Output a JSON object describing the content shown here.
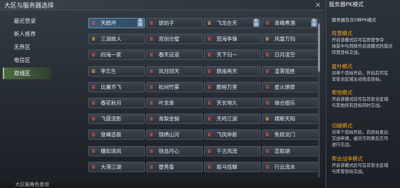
{
  "header": {
    "title": "大区与服务器选择",
    "close_glyph": "×"
  },
  "sidebar": {
    "items": [
      {
        "label": "最近登录",
        "active": false
      },
      {
        "label": "新人推荐",
        "active": false
      },
      {
        "label": "无界区",
        "active": false
      },
      {
        "label": "电信区",
        "active": false
      },
      {
        "label": "双线区",
        "active": true
      }
    ]
  },
  "servers": [
    {
      "name": "天鹤坪",
      "crown": "red",
      "tag": "新服",
      "highlight": true
    },
    {
      "name": "琥珀子",
      "crown": "red",
      "tag": "",
      "highlight": false
    },
    {
      "name": "飞龙在天",
      "crown": "gold",
      "tag": "新服",
      "highlight": false
    },
    {
      "name": "青梅煮酒",
      "crown": "red",
      "tag": "新服",
      "highlight": false
    },
    {
      "name": "江湖故人",
      "crown": "gold",
      "tag": "",
      "highlight": false
    },
    {
      "name": "双剑合璧",
      "crown": "red",
      "tag": "",
      "highlight": false
    },
    {
      "name": "怒海争锋",
      "crown": "red",
      "tag": "",
      "highlight": false
    },
    {
      "name": "风雷万钧",
      "crown": "gold",
      "tag": "",
      "highlight": false
    },
    {
      "name": "四海一家",
      "crown": "red",
      "tag": "",
      "highlight": false
    },
    {
      "name": "春天证道",
      "crown": "red",
      "tag": "",
      "highlight": false
    },
    {
      "name": "天下归一",
      "crown": "red",
      "tag": "",
      "highlight": false
    },
    {
      "name": "日月凌空",
      "crown": "red",
      "tag": "",
      "highlight": false
    },
    {
      "name": "李忘生",
      "crown": "gold",
      "tag": "",
      "highlight": false
    },
    {
      "name": "风月同天",
      "crown": "red",
      "tag": "",
      "highlight": false
    },
    {
      "name": "鹊南再天",
      "crown": "red",
      "tag": "",
      "highlight": false
    },
    {
      "name": "凌霄揽胜",
      "crown": "red",
      "tag": "",
      "highlight": false
    },
    {
      "name": "比翼齐飞",
      "crown": "red",
      "tag": "",
      "highlight": false
    },
    {
      "name": "松间竹雾",
      "crown": "red",
      "tag": "",
      "highlight": false
    },
    {
      "name": "鹏程万里",
      "crown": "red",
      "tag": "",
      "highlight": false
    },
    {
      "name": "星火燎原",
      "crown": "red",
      "tag": "",
      "highlight": false
    },
    {
      "name": "春花秋月",
      "crown": "red",
      "tag": "",
      "highlight": false
    },
    {
      "name": "叶龙青",
      "crown": "red",
      "tag": "",
      "highlight": false
    },
    {
      "name": "天长地久",
      "crown": "red",
      "tag": "",
      "highlight": false
    },
    {
      "name": "缘合佃乐",
      "crown": "red",
      "tag": "",
      "highlight": false
    },
    {
      "name": "飞霞流影",
      "crown": "red",
      "tag": "",
      "highlight": false
    },
    {
      "name": "青梨金骊",
      "crown": "red",
      "tag": "",
      "highlight": false
    },
    {
      "name": "天鸣江湖",
      "crown": "red",
      "tag": "",
      "highlight": false
    },
    {
      "name": "横断天阳",
      "crown": "gold",
      "tag": "",
      "highlight": false
    },
    {
      "name": "登峰造极",
      "crown": "red",
      "tag": "",
      "highlight": false
    },
    {
      "name": "锦绣山河",
      "crown": "red",
      "tag": "",
      "highlight": false
    },
    {
      "name": "飞凤岸新",
      "crown": "red",
      "tag": "",
      "highlight": false
    },
    {
      "name": "鱼跃龙门",
      "crown": "red",
      "tag": "",
      "highlight": false
    },
    {
      "name": "穗如清风",
      "crown": "red",
      "tag": "",
      "highlight": false
    },
    {
      "name": "铁血丹心",
      "crown": "red",
      "tag": "",
      "highlight": false
    },
    {
      "name": "千古风流",
      "crown": "red",
      "tag": "",
      "highlight": false
    },
    {
      "name": "恋叙胡",
      "crown": "red",
      "tag": "",
      "highlight": false
    },
    {
      "name": "大漠江湖",
      "crown": "red",
      "tag": "",
      "highlight": false
    },
    {
      "name": "替秀香",
      "crown": "red",
      "tag": "",
      "highlight": false
    },
    {
      "name": "叙马恬驛",
      "crown": "red",
      "tag": "",
      "highlight": false
    },
    {
      "name": "行云流水",
      "crown": "red",
      "tag": "",
      "highlight": false
    }
  ],
  "footer": {
    "text": "大区服角色查询"
  },
  "info_panel": {
    "title": "服务器PK模式",
    "intro": "服务器包含5种PK模式",
    "modes": [
      {
        "name": "阵营模式",
        "lines": [
          "开启该模式后可在阵营争夺",
          "场景中与同样开启该模式的敌对",
          "阵营目标交战。"
        ]
      },
      {
        "name": "复叶模式",
        "lines": [
          "对单个目标开启，开启后可在",
          "非安全区域主动攻击目标。"
        ]
      },
      {
        "name": "帮怪模式",
        "lines": [
          "开启该模式后可在非安全区域",
          "与其他所有目标同时交战。"
        ]
      },
      {
        "name": "切磋模式",
        "lines": [
          "对单个目标开启，向目标发出",
          "交战申请，被对方同意后方可",
          "进行交战。"
        ]
      },
      {
        "name": "帮会战争模式",
        "lines": [
          "开启该模式后可在非安全区域",
          "与阵营目标交战。"
        ]
      }
    ]
  },
  "colors": {
    "accent_orange": "#f0a820",
    "active_green": "#4b6b43",
    "highlight_blue": "#3d5b78"
  }
}
